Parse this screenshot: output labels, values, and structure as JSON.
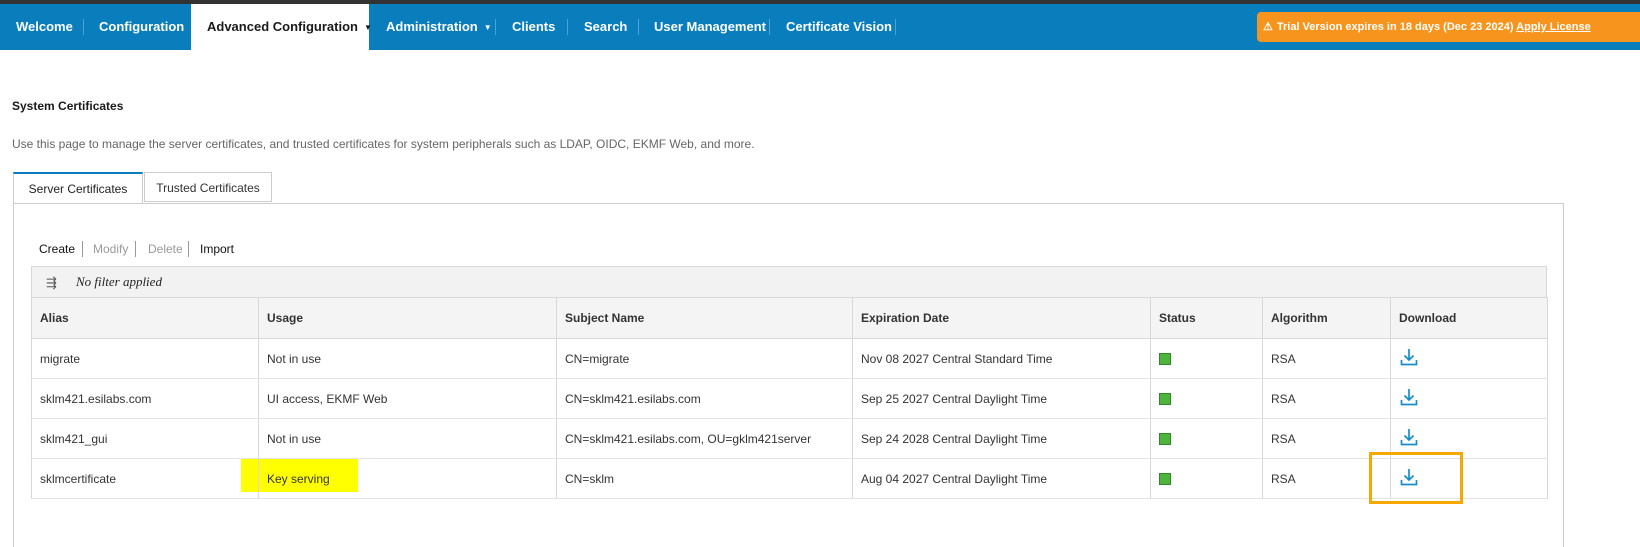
{
  "nav": {
    "items": [
      {
        "label": "Welcome"
      },
      {
        "label": "Configuration"
      },
      {
        "label": "Advanced Configuration"
      },
      {
        "label": "Administration"
      },
      {
        "label": "Clients"
      },
      {
        "label": "Search"
      },
      {
        "label": "User Management"
      },
      {
        "label": "Certificate Vision"
      }
    ],
    "active": "Advanced Configuration",
    "trial_text": "Trial Version expires in 18 days (Dec 23 2024)",
    "trial_link": "Apply License"
  },
  "page": {
    "title": "System Certificates",
    "description": "Use this page to manage the server certificates, and trusted certificates for system peripherals such as LDAP, OIDC, EKMF Web, and more."
  },
  "tabs": [
    {
      "label": "Server Certificates",
      "active": true
    },
    {
      "label": "Trusted Certificates",
      "active": false
    }
  ],
  "toolbar": {
    "create": "Create",
    "modify": "Modify",
    "delete": "Delete",
    "import": "Import"
  },
  "filter": {
    "text": "No filter applied"
  },
  "table": {
    "headers": [
      "Alias",
      "Usage",
      "Subject Name",
      "Expiration Date",
      "Status",
      "Algorithm",
      "Download"
    ],
    "rows": [
      {
        "alias": "migrate",
        "usage": "Not in use",
        "subject": "CN=migrate",
        "expiration": "Nov 08 2027 Central Standard Time",
        "status": "ok",
        "algorithm": "RSA"
      },
      {
        "alias": "sklm421.esilabs.com",
        "usage": "UI access, EKMF Web",
        "subject": "CN=sklm421.esilabs.com",
        "expiration": "Sep 25 2027 Central Daylight Time",
        "status": "ok",
        "algorithm": "RSA"
      },
      {
        "alias": "sklm421_gui",
        "usage": "Not in use",
        "subject": "CN=sklm421.esilabs.com, OU=gklm421server",
        "expiration": "Sep 24 2028 Central Daylight Time",
        "status": "ok",
        "algorithm": "RSA"
      },
      {
        "alias": "sklmcertificate",
        "usage": "Key serving",
        "subject": "CN=sklm",
        "expiration": "Aug 04 2027 Central Daylight Time",
        "status": "ok",
        "algorithm": "RSA"
      }
    ]
  },
  "colors": {
    "nav_bg": "#0a7ebd",
    "trial_bg": "#f7941d",
    "status_ok": "#4db33d",
    "download_icon": "#1a8ccc",
    "highlight_yellow": "#ffff00",
    "highlight_orange": "#f5a800"
  }
}
